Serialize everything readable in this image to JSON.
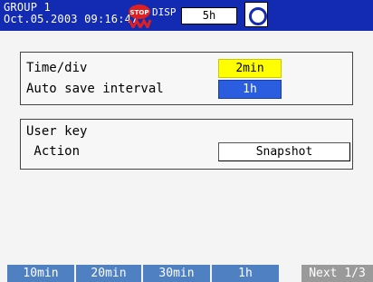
{
  "header": {
    "group": "GROUP 1",
    "datetime": "Oct.05.2003 09:16:47",
    "stop_icon": "stop-memory-icon",
    "disp_label": "DISP",
    "disp_value": "5h",
    "memory_icon": "memory-card-icon"
  },
  "settings": {
    "time_div_label": "Time/div",
    "time_div_value": "2min",
    "auto_save_label": "Auto save interval",
    "auto_save_value": "1h"
  },
  "user_key": {
    "title": "User key",
    "action_label": " Action",
    "action_value": "Snapshot"
  },
  "softkeys": {
    "options": [
      "10min",
      "20min",
      "30min",
      "1h"
    ],
    "next_label": "Next 1/3"
  },
  "colors": {
    "header_bg": "#122bb2",
    "selected_value": "#ffff00",
    "highlight_value": "#2a5de0",
    "softkey_bg": "#4f80c2"
  }
}
